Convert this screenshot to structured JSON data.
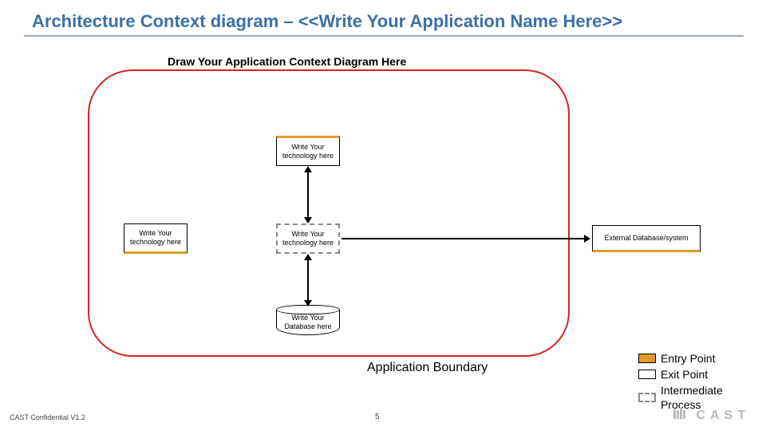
{
  "title": "Architecture Context diagram – <<Write Your Application Name Here>>",
  "subtitle": "Draw Your Application Context Diagram Here",
  "boxes": {
    "top_entry": "Write Your technology here",
    "left_entry": "Write Your technology here",
    "center": "Write Your technology here",
    "db": "Write Your Database here",
    "external": "External Database/system"
  },
  "boundary_label": "Application Boundary",
  "legend": {
    "entry": "Entry Point",
    "exit": "Exit Point",
    "intermediate": "Intermediate Process"
  },
  "footer": {
    "left": "CAST Confidential V1.2",
    "page": "5",
    "brand": "CAST"
  }
}
